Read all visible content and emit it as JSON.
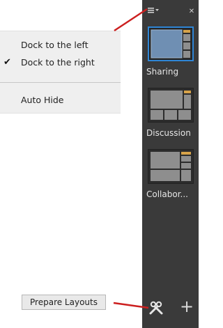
{
  "menu": {
    "items": [
      {
        "label": "Dock to the left",
        "checked": false
      },
      {
        "label": "Dock to the right",
        "checked": true
      },
      {
        "label": "Auto Hide",
        "checked": false
      }
    ],
    "check_glyph": "✔"
  },
  "dock": {
    "menu_icon": "hamburger-menu-icon",
    "close_icon": "close-icon",
    "layouts": [
      {
        "title": "Sharing",
        "selected": true
      },
      {
        "title": "Discussion",
        "selected": false
      },
      {
        "title": "Collabor...",
        "selected": false
      }
    ]
  },
  "bottom": {
    "tooltip": "Prepare Layouts",
    "tool_icon": "tools-icon",
    "add_icon": "plus-icon",
    "add_glyph": "+"
  },
  "colors": {
    "dock_bg": "#3a3a3a",
    "selected_border": "#2f86d6",
    "thumb_fill": "#6f8fb3",
    "annotation": "#cc1f1f"
  }
}
